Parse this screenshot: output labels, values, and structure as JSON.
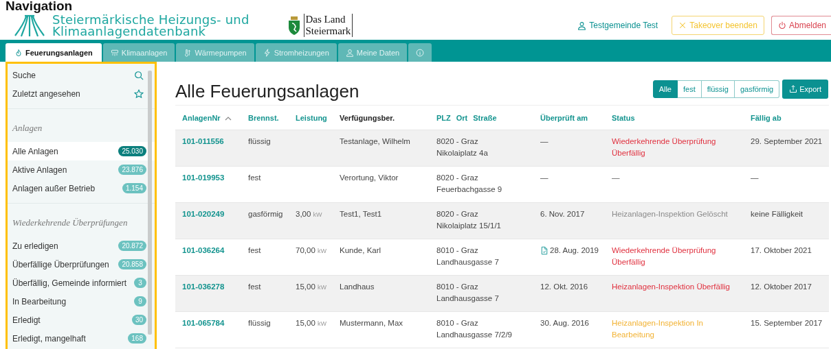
{
  "heading": "Navigation",
  "brand": {
    "title_line1": "Steiermärkische Heizungs- und",
    "title_line2": "Klimaanlagendatenbank",
    "partner_line1": "Das Land",
    "partner_line2": "Steiermark"
  },
  "user": {
    "name": "Testgemeinde Test"
  },
  "header_buttons": [
    {
      "kind": "takeover",
      "label": "Takeover beenden"
    },
    {
      "kind": "logout",
      "label": "Abmelden"
    }
  ],
  "tabs": [
    {
      "kind": "flame",
      "label": "Feuerungsanlagen",
      "selected": true
    },
    {
      "kind": "fan",
      "label": "Klimaanlagen",
      "selected": false
    },
    {
      "kind": "thermometer",
      "label": "Wärmepumpen",
      "selected": false
    },
    {
      "kind": "bolt",
      "label": "Stromheizungen",
      "selected": false
    },
    {
      "kind": "user",
      "label": "Meine Daten",
      "selected": false
    },
    {
      "kind": "info",
      "selected": false
    }
  ],
  "sidebar": {
    "top_items": [
      {
        "kind": "search",
        "label": "Suche"
      },
      {
        "kind": "star",
        "label": "Zuletzt angesehen"
      }
    ],
    "groups": [
      {
        "title": "Anlagen",
        "items": [
          {
            "label": "Alle Anlagen",
            "count": "25.030",
            "selected": true
          },
          {
            "label": "Aktive Anlagen",
            "count": "23.876",
            "selected": false
          },
          {
            "label": "Anlagen außer Betrieb",
            "count": "1.154",
            "selected": false
          }
        ]
      },
      {
        "title": "Wiederkehrende Überprüfungen",
        "items": [
          {
            "label": "Zu erledigen",
            "count": "20.872",
            "selected": false
          },
          {
            "label": "Überfällige Überprüfungen",
            "count": "20.858",
            "selected": false
          },
          {
            "label": "Überfällig, Gemeinde informiert",
            "count": "3",
            "selected": false
          },
          {
            "label": "In Bearbeitung",
            "count": "9",
            "selected": false
          },
          {
            "label": "Erledigt",
            "count": "30",
            "selected": false
          },
          {
            "label": "Erledigt, mangelhaft",
            "count": "168",
            "selected": false
          }
        ]
      }
    ]
  },
  "page_title": "Alle Feuerungsanlagen",
  "filters": [
    {
      "label": "Alle",
      "selected": true
    },
    {
      "label": "fest",
      "selected": false
    },
    {
      "label": "flüssig",
      "selected": false
    },
    {
      "label": "gasförmig",
      "selected": false
    }
  ],
  "export_button": "Export",
  "table": {
    "columns": [
      {
        "labels": [
          "AnlagenNr"
        ],
        "sortable": true,
        "sorted": true
      },
      {
        "labels": [
          "Brennst."
        ],
        "sortable": true,
        "sorted": false
      },
      {
        "labels": [
          "Leistung"
        ],
        "sortable": true,
        "sorted": false
      },
      {
        "labels": [
          "Verfügungsber."
        ],
        "sortable": false,
        "sorted": false
      },
      {
        "labels": [
          "PLZ",
          "Ort",
          "Straße"
        ],
        "sortable": true,
        "sorted": false
      },
      {
        "labels": [
          "Überprüft am"
        ],
        "sortable": true,
        "sorted": false
      },
      {
        "labels": [
          "Status"
        ],
        "sortable": true,
        "sorted": false
      },
      {
        "labels": [
          "Fällig ab"
        ],
        "sortable": true,
        "sorted": false
      }
    ],
    "rows": [
      {
        "number": "101-011556",
        "fuel": "flüssig",
        "owner": "Testanlage, Wilhelm",
        "city": "8020 - Graz",
        "street": "Nikolaiplatz 4a",
        "checked_on": "—",
        "has_document": false,
        "status": {
          "text": "Wiederkehrende Überprüfung Überfällig",
          "kind": "overdue"
        },
        "due": "29. September 2021"
      },
      {
        "number": "101-019953",
        "fuel": "fest",
        "owner": "Verortung, Viktor",
        "city": "8020 - Graz",
        "street": "Feuerbachgasse 9",
        "checked_on": "—",
        "has_document": false,
        "status": {
          "text": "—",
          "kind": "none"
        },
        "due": "—"
      },
      {
        "number": "101-020249",
        "fuel": "gasförmig",
        "power": {
          "value": "3,00",
          "unit": "kW"
        },
        "owner": "Test1, Test1",
        "city": "8020 - Graz",
        "street": "Nikolaiplatz 15/1/1",
        "checked_on": "6. Nov. 2017",
        "has_document": false,
        "status": {
          "text": "Heizanlagen-Inspektion Gelöscht",
          "kind": "deleted"
        },
        "due": "keine Fälligkeit"
      },
      {
        "number": "101-036264",
        "fuel": "fest",
        "power": {
          "value": "70,00",
          "unit": "kW"
        },
        "owner": "Kunde, Karl",
        "city": "8010 - Graz",
        "street": "Landhausgasse 7",
        "checked_on": "28. Aug. 2019",
        "has_document": true,
        "status": {
          "text": "Wiederkehrende Überprüfung Überfällig",
          "kind": "overdue"
        },
        "due": "17. Oktober 2021"
      },
      {
        "number": "101-036278",
        "fuel": "fest",
        "power": {
          "value": "15,00",
          "unit": "kW"
        },
        "owner": "Landhaus",
        "city": "8010 - Graz",
        "street": "Landhausgasse 7",
        "checked_on": "12. Okt. 2016",
        "has_document": false,
        "status": {
          "text": "Heizanlagen-Inspektion Überfällig",
          "kind": "overdue"
        },
        "due": "12. Oktober 2017"
      },
      {
        "number": "101-065784",
        "fuel": "flüssig",
        "power": {
          "value": "15,00",
          "unit": "kW"
        },
        "owner": "Mustermann, Max",
        "city": "8010 - Graz",
        "street": "Landhausgasse 7/2/9",
        "checked_on": "30. Aug. 2016",
        "has_document": false,
        "status": {
          "text": "Heizanlagen-Inspektion In Bearbeitung",
          "kind": "in_progress"
        },
        "due": "15. September 2017"
      }
    ]
  }
}
